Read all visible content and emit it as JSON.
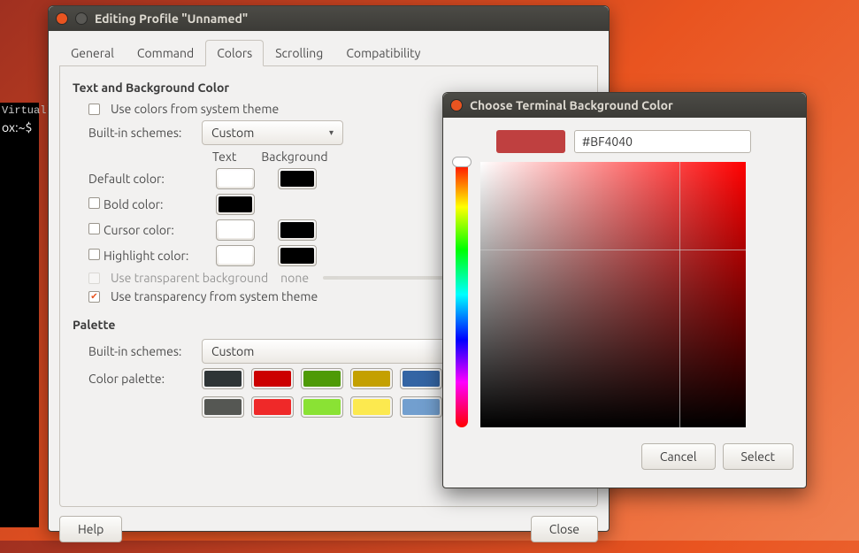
{
  "terminal": {
    "line1": "Virtuall",
    "prompt": "ox:~$"
  },
  "mainWindow": {
    "title": "Editing Profile \"Unnamed\"",
    "tabs": [
      "General",
      "Command",
      "Colors",
      "Scrolling",
      "Compatibility"
    ],
    "activeTab": 2,
    "section1": "Text and Background Color",
    "useSystemColors": "Use colors from system theme",
    "builtInSchemesLabel": "Built-in schemes:",
    "builtInScheme": "Custom",
    "headText": "Text",
    "headBg": "Background",
    "defaultColor": "Default color:",
    "boldColor": "Bold color:",
    "cursorColor": "Cursor color:",
    "highlightColor": "Highlight color:",
    "useTransparent": "Use transparent background",
    "transparentValue": "none",
    "useTransparencyTheme": "Use transparency from system theme",
    "section2": "Palette",
    "paletteScheme": "Custom",
    "colorPaletteLabel": "Color palette:",
    "colors": {
      "defaultText": "#FFFFFF",
      "defaultBg": "#000000",
      "boldText": "#000000",
      "cursorText": "#FFFFFF",
      "cursorBg": "#000000",
      "hlText": "#FFFFFF",
      "hlBg": "#000000"
    },
    "palette": [
      "#2E3436",
      "#CC0000",
      "#4E9A06",
      "#C4A000",
      "#3465A4",
      "#555753",
      "#EF2929",
      "#8AE234",
      "#FCE94F",
      "#729FCF"
    ],
    "help": "Help",
    "close": "Close"
  },
  "colorPicker": {
    "title": "Choose Terminal Background Color",
    "hex": "#BF4040",
    "preview": "#BF4040",
    "cancel": "Cancel",
    "select": "Select"
  }
}
